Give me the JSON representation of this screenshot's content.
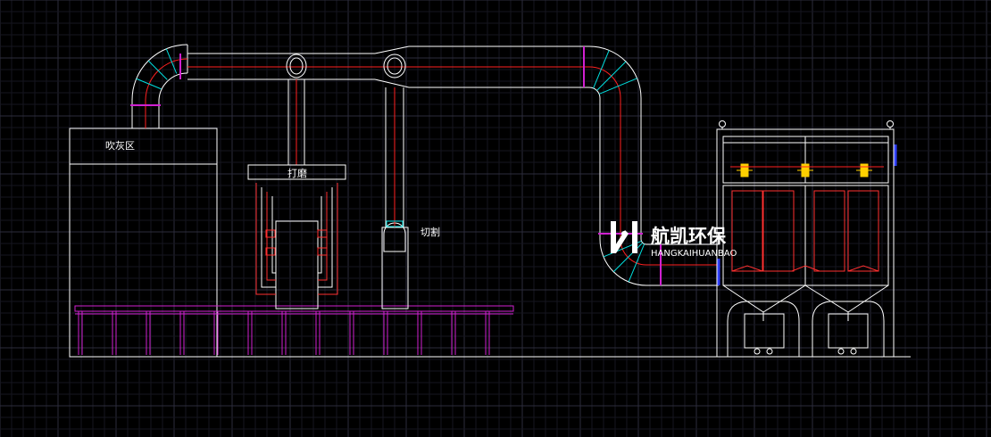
{
  "labels": {
    "blow_zone": "吹灰区",
    "grinding": "打磨",
    "cutting": "切割"
  },
  "logo": {
    "chinese": "航凯环保",
    "pinyin": "HANGKAIHUANBAO"
  },
  "colors": {
    "background": "#000000",
    "grid_minor": "#1a1a26",
    "grid_major": "#2c2c3c",
    "outline": "#ffffff",
    "duct_center": "#ff2020",
    "elbow_accent": "#00e0e0",
    "flange": "#d020d0",
    "valve": "#ffd000",
    "bag": "#ff3030",
    "equipment_blue": "#3040ff"
  }
}
